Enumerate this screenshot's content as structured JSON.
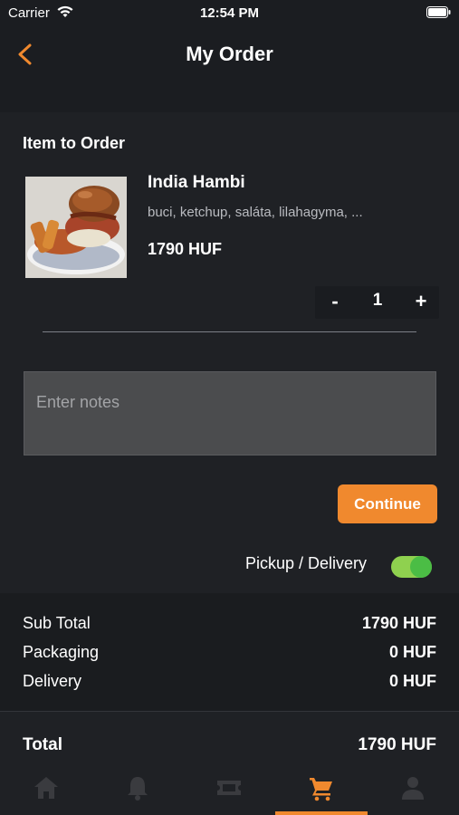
{
  "status_bar": {
    "carrier": "Carrier",
    "time": "12:54 PM"
  },
  "header": {
    "title": "My Order"
  },
  "order": {
    "section_title": "Item to Order",
    "item": {
      "name": "India Hambi",
      "description": "buci, ketchup, saláta, lilahagyma, ...",
      "price": "1790 HUF"
    },
    "quantity": {
      "minus": "-",
      "value": "1",
      "plus": "+"
    },
    "notes": {
      "placeholder": "Enter notes",
      "value": ""
    },
    "continue_label": "Continue",
    "delivery": {
      "label": "Pickup / Delivery",
      "enabled": true
    }
  },
  "summary": {
    "rows": [
      {
        "label": "Sub Total",
        "value": "1790 HUF"
      },
      {
        "label": "Packaging",
        "value": "0 HUF"
      },
      {
        "label": "Delivery",
        "value": "0 HUF"
      }
    ],
    "total": {
      "label": "Total",
      "value": "1790 HUF"
    }
  },
  "tab_bar": {
    "tabs": [
      {
        "icon": "home-icon",
        "active": false
      },
      {
        "icon": "bell-icon",
        "active": false
      },
      {
        "icon": "ticket-icon",
        "active": false
      },
      {
        "icon": "cart-icon",
        "active": true
      },
      {
        "icon": "person-icon",
        "active": false
      }
    ]
  },
  "colors": {
    "accent": "#f0892e",
    "background": "#1f2125",
    "toggle_on": "#8fd14f"
  }
}
